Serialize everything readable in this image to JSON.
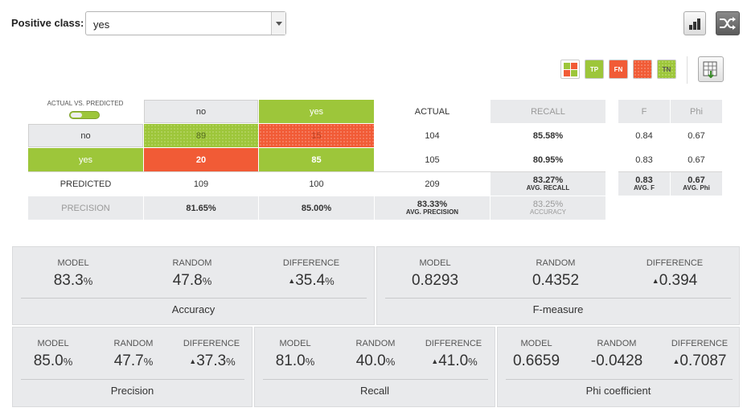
{
  "header": {
    "positive_class_label": "Positive class:",
    "positive_class_value": "yes"
  },
  "legend": {
    "tp": "TP",
    "fn": "FN",
    "tn": "TN"
  },
  "matrix": {
    "corner_label": "ACTUAL VS. PREDICTED",
    "col_no": "no",
    "col_yes": "yes",
    "col_actual": "ACTUAL",
    "col_recall": "RECALL",
    "col_f": "F",
    "col_phi": "Phi",
    "row_no": {
      "label": "no",
      "no": "89",
      "yes": "15",
      "actual": "104",
      "recall": "85.58%",
      "f": "0.84",
      "phi": "0.67"
    },
    "row_yes": {
      "label": "yes",
      "no": "20",
      "yes": "85",
      "actual": "105",
      "recall": "80.95%",
      "f": "0.83",
      "phi": "0.67"
    },
    "row_predicted": {
      "label": "PREDICTED",
      "no": "109",
      "yes": "100",
      "total": "209",
      "avg_recall": "83.27%",
      "avg_recall_label": "AVG. RECALL",
      "avg_f": "0.83",
      "avg_f_label": "AVG. F",
      "avg_phi": "0.67",
      "avg_phi_label": "AVG. Phi"
    },
    "row_precision": {
      "label": "PRECISION",
      "no": "81.65%",
      "yes": "85.00%",
      "avg_precision": "83.33%",
      "avg_precision_label": "AVG. PRECISION",
      "accuracy": "83.25%",
      "accuracy_label": "ACCURACY"
    }
  },
  "metrics": {
    "col_model": "MODEL",
    "col_random": "RANDOM",
    "col_difference": "DIFFERENCE",
    "accuracy": {
      "title": "Accuracy",
      "model": "83.3",
      "random": "47.8",
      "difference": "35.4",
      "unit": "%"
    },
    "fmeasure": {
      "title": "F-measure",
      "model": "0.8293",
      "random": "0.4352",
      "difference": "0.394"
    },
    "precision": {
      "title": "Precision",
      "model": "85.0",
      "random": "47.7",
      "difference": "37.3",
      "unit": "%"
    },
    "recall": {
      "title": "Recall",
      "model": "81.0",
      "random": "40.0",
      "difference": "41.0",
      "unit": "%"
    },
    "phi": {
      "title": "Phi coefficient",
      "model": "0.6659",
      "random": "-0.0428",
      "difference": "0.7087"
    }
  },
  "colors": {
    "tp_green": "#9dc63a",
    "fn_red": "#f15b36",
    "panel_grey": "#e9eaec"
  }
}
